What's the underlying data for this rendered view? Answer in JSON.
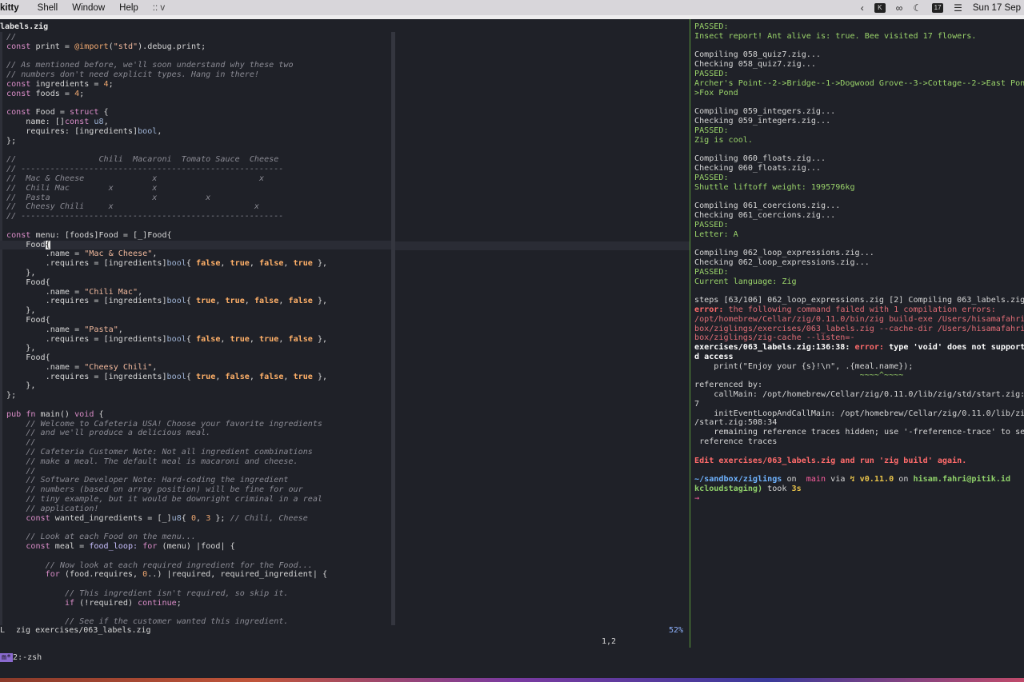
{
  "menubar": {
    "app": "kitty",
    "items": [
      "Shell",
      "Window",
      "Help"
    ],
    "title": ":: v",
    "clock": "Sun 17 Sep",
    "icons": [
      "chevron-left-icon",
      "k-app-icon",
      "link-icon",
      "moon-icon",
      "calendar-icon",
      "control-center-icon"
    ],
    "calendar_badge": "17",
    "k_badge": "K"
  },
  "editor": {
    "tab": "labels.zig",
    "mode": "L",
    "file": "zig exercises/063_labels.zig",
    "position": "1,2",
    "percent": "52%"
  },
  "code_lines": [
    "//",
    "const print = @import(\"std\").debug.print;",
    "",
    "// As mentioned before, we'll soon understand why these two",
    "// numbers don't need explicit types. Hang in there!",
    "const ingredients = 4;",
    "const foods = 4;",
    "",
    "const Food = struct {",
    "    name: []const u8,",
    "    requires: [ingredients]bool,",
    "};",
    "",
    "//                 Chili  Macaroni  Tomato Sauce  Cheese",
    "// ------------------------------------------------------",
    "//  Mac & Cheese              x                     x",
    "//  Chili Mac        x        x",
    "//  Pasta                     x          x",
    "//  Cheesy Chili     x                             x",
    "// ------------------------------------------------------",
    "",
    "const menu: [foods]Food = [_]Food{",
    "    Food{",
    "        .name = \"Mac & Cheese\",",
    "        .requires = [ingredients]bool{ false, true, false, true },",
    "    },",
    "    Food{",
    "        .name = \"Chili Mac\",",
    "        .requires = [ingredients]bool{ true, true, false, false },",
    "    },",
    "    Food{",
    "        .name = \"Pasta\",",
    "        .requires = [ingredients]bool{ false, true, true, false },",
    "    },",
    "    Food{",
    "        .name = \"Cheesy Chili\",",
    "        .requires = [ingredients]bool{ true, false, false, true },",
    "    },",
    "};",
    "",
    "pub fn main() void {",
    "    // Welcome to Cafeteria USA! Choose your favorite ingredients",
    "    // and we'll produce a delicious meal.",
    "    //",
    "    // Cafeteria Customer Note: Not all ingredient combinations",
    "    // make a meal. The default meal is macaroni and cheese.",
    "    //",
    "    // Software Developer Note: Hard-coding the ingredient",
    "    // numbers (based on array position) will be fine for our",
    "    // tiny example, but it would be downright criminal in a real",
    "    // application!",
    "    const wanted_ingredients = [_]u8{ 0, 3 }; // Chili, Cheese",
    "",
    "    // Look at each Food on the menu...",
    "    const meal = food_loop: for (menu) |food| {",
    "",
    "        // Now look at each required ingredient for the Food...",
    "        for (food.requires, 0..) |required, required_ingredient| {",
    "",
    "            // This ingredient isn't required, so skip it.",
    "            if (!required) continue;",
    "",
    "            // See if the customer wanted this ingredient."
  ],
  "terminal_lines": [
    "PASSED:",
    "Insect report! Ant alive is: true. Bee visited 17 flowers.",
    "",
    "Compiling 058_quiz7.zig...",
    "Checking 058_quiz7.zig...",
    "PASSED:",
    "Archer's Point--2->Bridge--1->Dogwood Grove--3->Cottage--2->East Pon",
    ">Fox Pond",
    "",
    "Compiling 059_integers.zig...",
    "Checking 059_integers.zig...",
    "PASSED:",
    "Zig is cool.",
    "",
    "Compiling 060_floats.zig...",
    "Checking 060_floats.zig...",
    "PASSED:",
    "Shuttle liftoff weight: 1995796kg",
    "",
    "Compiling 061_coercions.zig...",
    "Checking 061_coercions.zig...",
    "PASSED:",
    "Letter: A",
    "",
    "Compiling 062_loop_expressions.zig...",
    "Checking 062_loop_expressions.zig...",
    "PASSED:",
    "Current language: Zig",
    "",
    "steps [63/106] 062_loop_expressions.zig [2] Compiling 063_labels.zig",
    "error: the following command failed with 1 compilation errors:",
    "/opt/homebrew/Cellar/zig/0.11.0/bin/zig build-exe /Users/hisamafahri",
    "box/ziglings/exercises/063_labels.zig --cache-dir /Users/hisamafahri",
    "box/ziglings/zig-cache --listen=-",
    "exercises/063_labels.zig:136:38: error: type 'void' does not support",
    "d access",
    "    print(\"Enjoy your {s}!\\n\", .{meal.name});",
    "                                  ~~~~^~~~~",
    "referenced by:",
    "    callMain: /opt/homebrew/Cellar/zig/0.11.0/lib/zig/std/start.zig:",
    "7",
    "    initEventLoopAndCallMain: /opt/homebrew/Cellar/zig/0.11.0/lib/zi",
    "/start.zig:508:34",
    "    remaining reference traces hidden; use '-freference-trace' to se",
    " reference traces",
    "",
    "Edit exercises/063_labels.zig and run 'zig build' again.",
    "",
    "~/sandbox/ziglings on  main via ↯ v0.11.0 on hisam.fahri@pitik.id",
    "kcloudstaging) took 3s",
    "→"
  ],
  "tmux": {
    "session": "m*",
    "window": "2:-zsh"
  },
  "colors": {
    "background": "#1f2128",
    "passed_green": "#9ad36a",
    "error_red": "#e06c75",
    "accent_purple": "#8a6acf"
  }
}
